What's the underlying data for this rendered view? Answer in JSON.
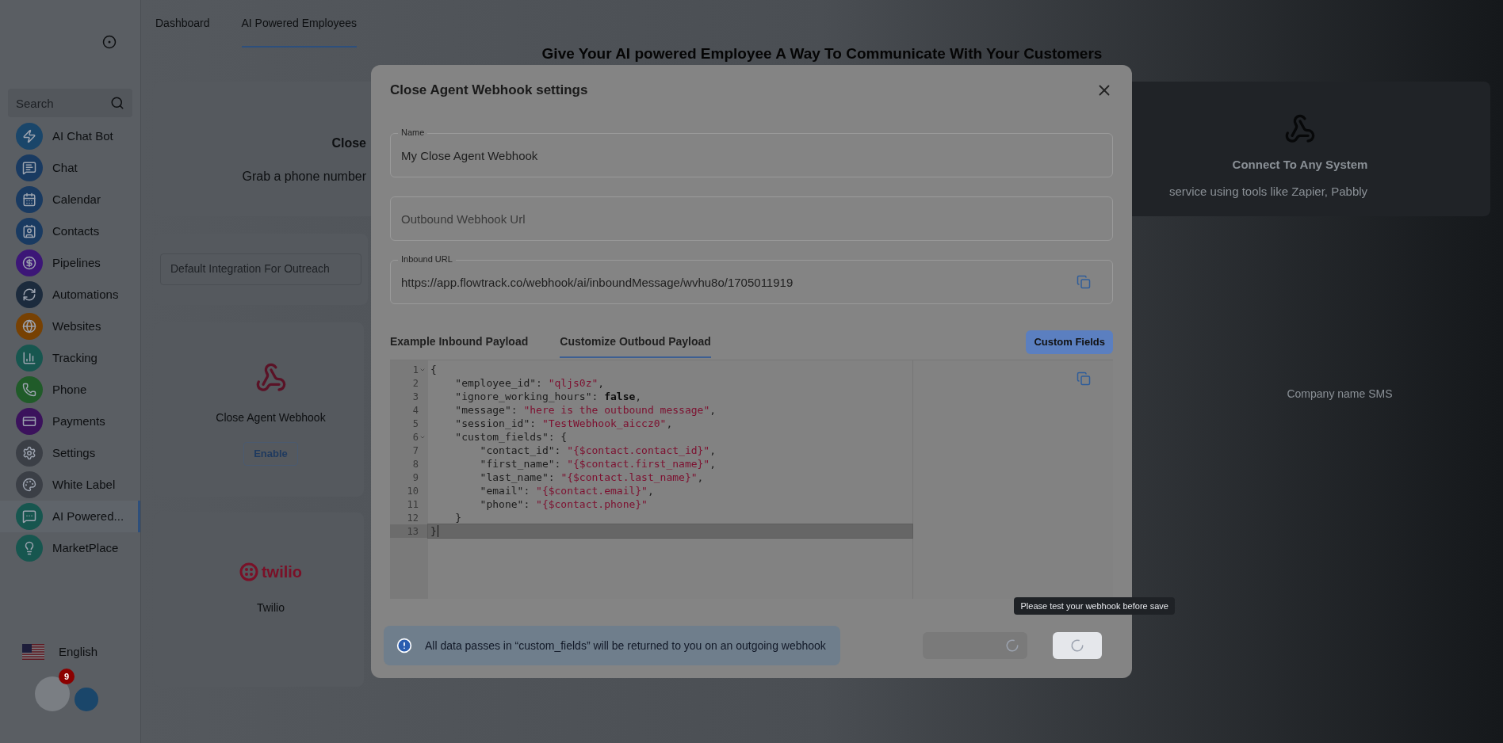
{
  "sidebar": {
    "search": {
      "placeholder": "Search"
    },
    "items": [
      {
        "label": "AI Chat Bot",
        "color": "#1a466a",
        "selected": false
      },
      {
        "label": "Chat",
        "color": "#193a61",
        "selected": false
      },
      {
        "label": "Calendar",
        "color": "#193a61",
        "selected": false
      },
      {
        "label": "Contacts",
        "color": "#193a61",
        "selected": false
      },
      {
        "label": "Pipelines",
        "color": "#3c1677",
        "selected": false
      },
      {
        "label": "Automations",
        "color": "#1c2b3d",
        "selected": false
      },
      {
        "label": "Websites",
        "color": "#774103",
        "selected": false
      },
      {
        "label": "Tracking",
        "color": "#17564f",
        "selected": false
      },
      {
        "label": "Phone",
        "color": "#205b29",
        "selected": false
      },
      {
        "label": "Payments",
        "color": "#3b125c",
        "selected": false
      },
      {
        "label": "Settings",
        "color": "#3b3f46",
        "selected": false
      },
      {
        "label": "White Label",
        "color": "#3b3f46",
        "selected": false
      },
      {
        "label": "AI Powered...",
        "color": "#17564f",
        "selected": true
      },
      {
        "label": "MarketPlace",
        "color": "#17564f",
        "selected": false
      }
    ],
    "language": "English",
    "notification_count": "9"
  },
  "tabs": [
    {
      "label": "Dashboard",
      "selected": false
    },
    {
      "label": "AI Powered Employees",
      "selected": true
    }
  ],
  "heading": "Give Your AI powered Employee A Way To Communicate With Your Customers",
  "channel_cards": [
    {
      "title": "Close",
      "description": "Grab a phone number"
    },
    {
      "title": "Connect To Any System",
      "description": "service using tools like Zapier, Pabbly"
    }
  ],
  "default_integration": {
    "placeholder": "Default Integration For Outreach"
  },
  "integrations": [
    {
      "kind": "webhook",
      "name": "Close Agent Webhook",
      "button": "Enable"
    },
    {
      "kind": "twilio",
      "logo_text": "twilio",
      "name": "Twilio"
    }
  ],
  "right_integration": {
    "name": "Company name SMS"
  },
  "modal": {
    "title": "Close Agent Webhook settings",
    "fields": [
      {
        "label": "Name",
        "value": "My Close Agent Webhook",
        "copyable": false
      },
      {
        "placeholder": "Outbound Webhook Url",
        "copyable": false
      },
      {
        "label": "Inbound URL",
        "value": "https://app.flowtrack.co/webhook/ai/inboundMessage/wvhu8o/1705011919",
        "copyable": true
      }
    ],
    "payload_tabs": [
      {
        "label": "Example Inbound Payload",
        "selected": false
      },
      {
        "label": "Customize Outboud Payload",
        "selected": true
      }
    ],
    "custom_fields_button": "Custom Fields",
    "editor": {
      "lines": [
        {
          "number": "1",
          "foldable": true,
          "active": false,
          "tokens": [
            {
              "kind": "punct",
              "text": "{"
            }
          ]
        },
        {
          "number": "2",
          "foldable": false,
          "active": false,
          "tokens": [
            {
              "kind": "key",
              "text": "    \"employee_id\": "
            },
            {
              "kind": "string",
              "text": "\"qljs0z\""
            },
            {
              "kind": "punct",
              "text": ","
            }
          ]
        },
        {
          "number": "3",
          "foldable": false,
          "active": false,
          "tokens": [
            {
              "kind": "key",
              "text": "    \"ignore_working_hours\": "
            },
            {
              "kind": "bool",
              "text": "false"
            },
            {
              "kind": "punct",
              "text": ","
            }
          ]
        },
        {
          "number": "4",
          "foldable": false,
          "active": false,
          "tokens": [
            {
              "kind": "key",
              "text": "    \"message\": "
            },
            {
              "kind": "string",
              "text": "\"here is the outbound message\""
            },
            {
              "kind": "punct",
              "text": ","
            }
          ]
        },
        {
          "number": "5",
          "foldable": false,
          "active": false,
          "tokens": [
            {
              "kind": "key",
              "text": "    \"session_id\": "
            },
            {
              "kind": "string",
              "text": "\"TestWebhook_aiccz0\""
            },
            {
              "kind": "punct",
              "text": ","
            }
          ]
        },
        {
          "number": "6",
          "foldable": true,
          "active": false,
          "tokens": [
            {
              "kind": "key",
              "text": "    \"custom_fields\": {"
            }
          ]
        },
        {
          "number": "7",
          "foldable": false,
          "active": false,
          "tokens": [
            {
              "kind": "key",
              "text": "        \"contact_id\": "
            },
            {
              "kind": "string",
              "text": "\"{$contact.contact_id}\""
            },
            {
              "kind": "punct",
              "text": ","
            }
          ]
        },
        {
          "number": "8",
          "foldable": false,
          "active": false,
          "tokens": [
            {
              "kind": "key",
              "text": "        \"first_name\": "
            },
            {
              "kind": "string",
              "text": "\"{$contact.first_name}\""
            },
            {
              "kind": "punct",
              "text": ","
            }
          ]
        },
        {
          "number": "9",
          "foldable": false,
          "active": false,
          "tokens": [
            {
              "kind": "key",
              "text": "        \"last_name\": "
            },
            {
              "kind": "string",
              "text": "\"{$contact.last_name}\""
            },
            {
              "kind": "punct",
              "text": ","
            }
          ]
        },
        {
          "number": "10",
          "foldable": false,
          "active": false,
          "tokens": [
            {
              "kind": "key",
              "text": "        \"email\": "
            },
            {
              "kind": "string",
              "text": "\"{$contact.email}\""
            },
            {
              "kind": "punct",
              "text": ","
            }
          ]
        },
        {
          "number": "11",
          "foldable": false,
          "active": false,
          "tokens": [
            {
              "kind": "key",
              "text": "        \"phone\": "
            },
            {
              "kind": "string",
              "text": "\"{$contact.phone}\""
            }
          ]
        },
        {
          "number": "12",
          "foldable": false,
          "active": false,
          "tokens": [
            {
              "kind": "punct",
              "text": "    }"
            }
          ]
        },
        {
          "number": "13",
          "foldable": false,
          "active": true,
          "tokens": [
            {
              "kind": "punct",
              "text": "}"
            }
          ]
        }
      ]
    },
    "info": "All data passes in “custom_fields” will be returned to you on an outgoing webhook",
    "tooltip": "Please test your webhook before save",
    "buttons": [
      {
        "kind": "secondary",
        "loading": true
      },
      {
        "kind": "primary",
        "loading": true
      }
    ]
  }
}
